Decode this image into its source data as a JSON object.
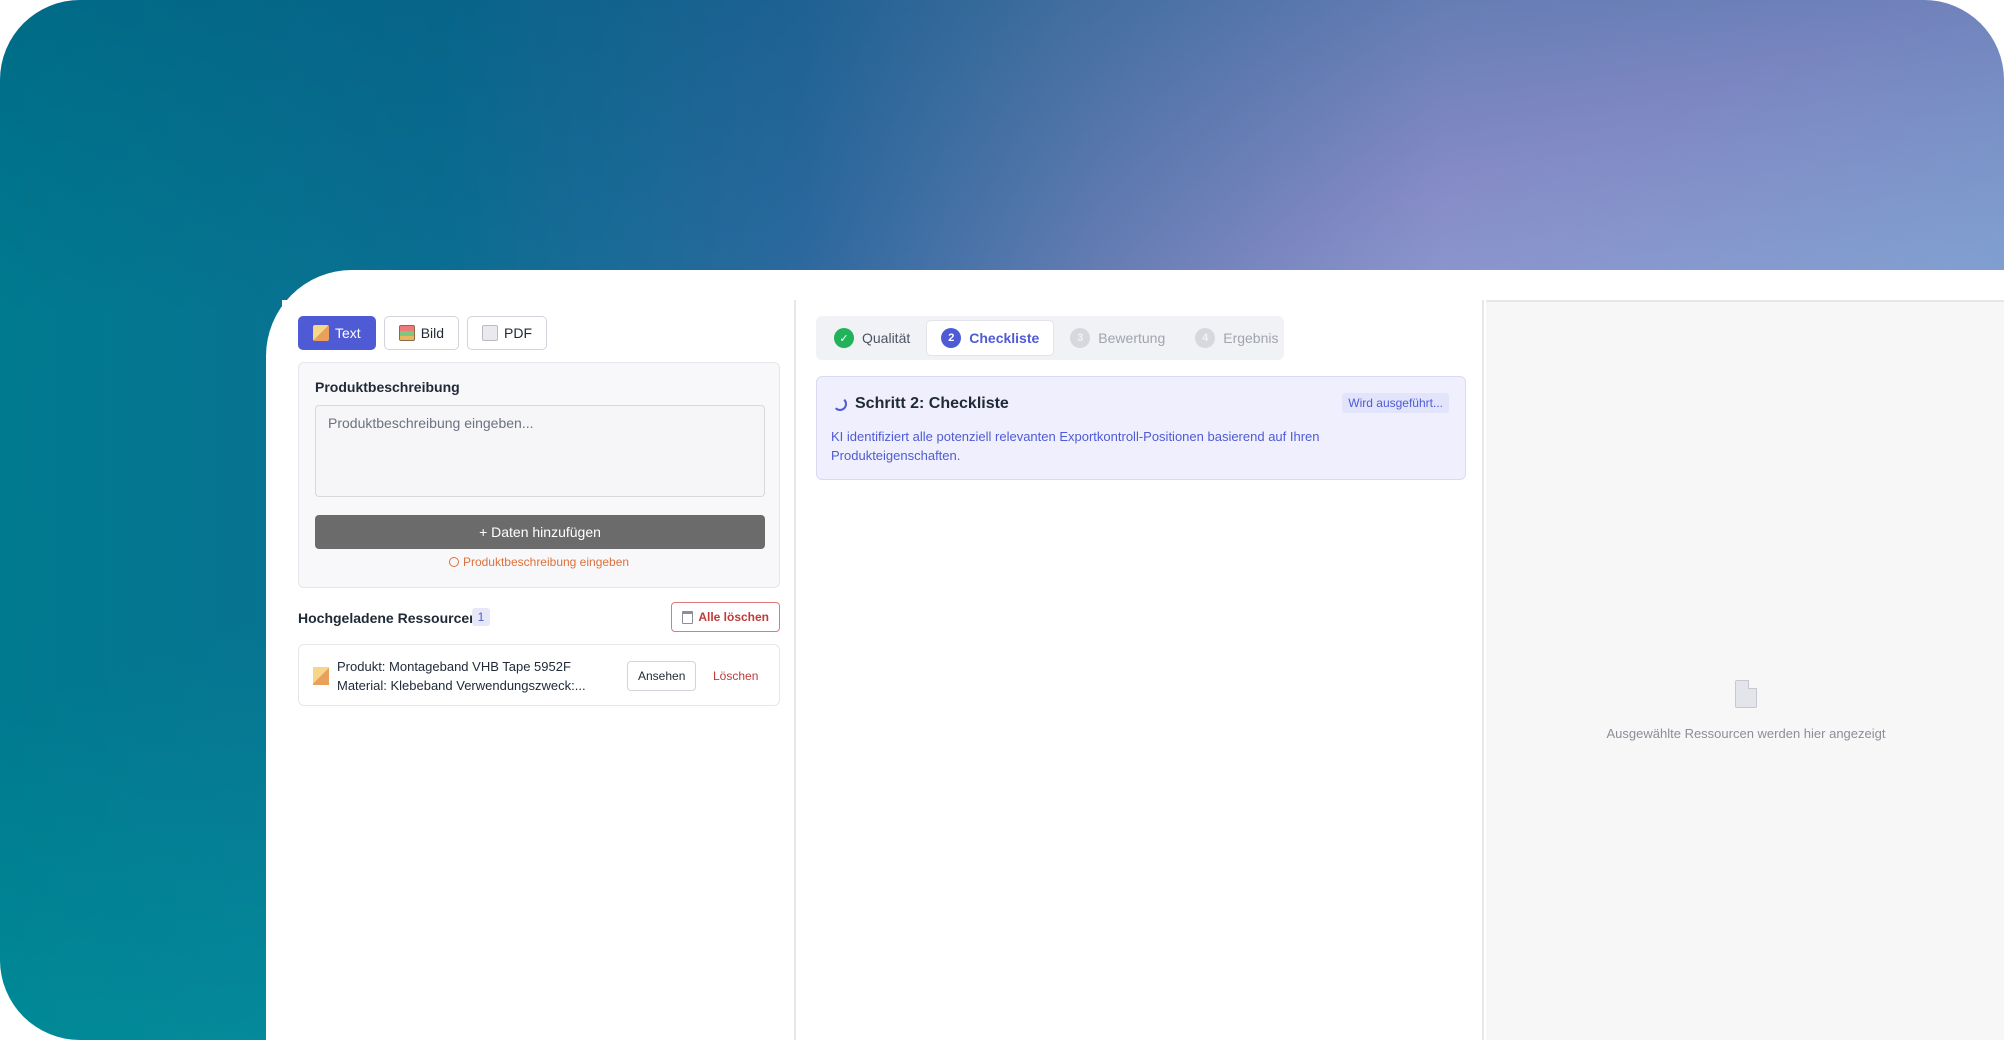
{
  "input_tabs": [
    {
      "label": "Text",
      "icon": "pencil-icon",
      "active": true
    },
    {
      "label": "Bild",
      "icon": "image-icon",
      "active": false
    },
    {
      "label": "PDF",
      "icon": "file-icon",
      "active": false
    }
  ],
  "description": {
    "title": "Produktbeschreibung",
    "placeholder": "Produktbeschreibung eingeben...",
    "add_button": "+ Daten hinzufügen",
    "hint": "Produktbeschreibung eingeben"
  },
  "resources": {
    "title": "Hochgeladene Ressourcen",
    "count": "1",
    "clear_all": "Alle löschen",
    "items": [
      {
        "line1": "Produkt: Montageband VHB Tape 5952F",
        "line2": "Material: Klebeband Verwendungszweck:...",
        "view_label": "Ansehen",
        "delete_label": "Löschen"
      }
    ]
  },
  "steps": [
    {
      "label": "Qualität",
      "marker": "✓",
      "state": "done"
    },
    {
      "label": "Checkliste",
      "marker": "2",
      "state": "current"
    },
    {
      "label": "Bewertung",
      "marker": "3",
      "state": "pending"
    },
    {
      "label": "Ergebnis",
      "marker": "4",
      "state": "pending"
    }
  ],
  "status": {
    "title": "Schritt 2: Checkliste",
    "badge": "Wird ausgeführt...",
    "description": "KI identifiziert alle potenziell relevanten Exportkontroll-Positionen basierend auf Ihren Produkteigenschaften."
  },
  "preview": {
    "placeholder": "Ausgewählte Ressourcen werden hier angezeigt"
  },
  "colors": {
    "accent": "#4f5bd5",
    "success": "#22b35a",
    "danger": "#c03a3a",
    "warning": "#e0703a"
  }
}
